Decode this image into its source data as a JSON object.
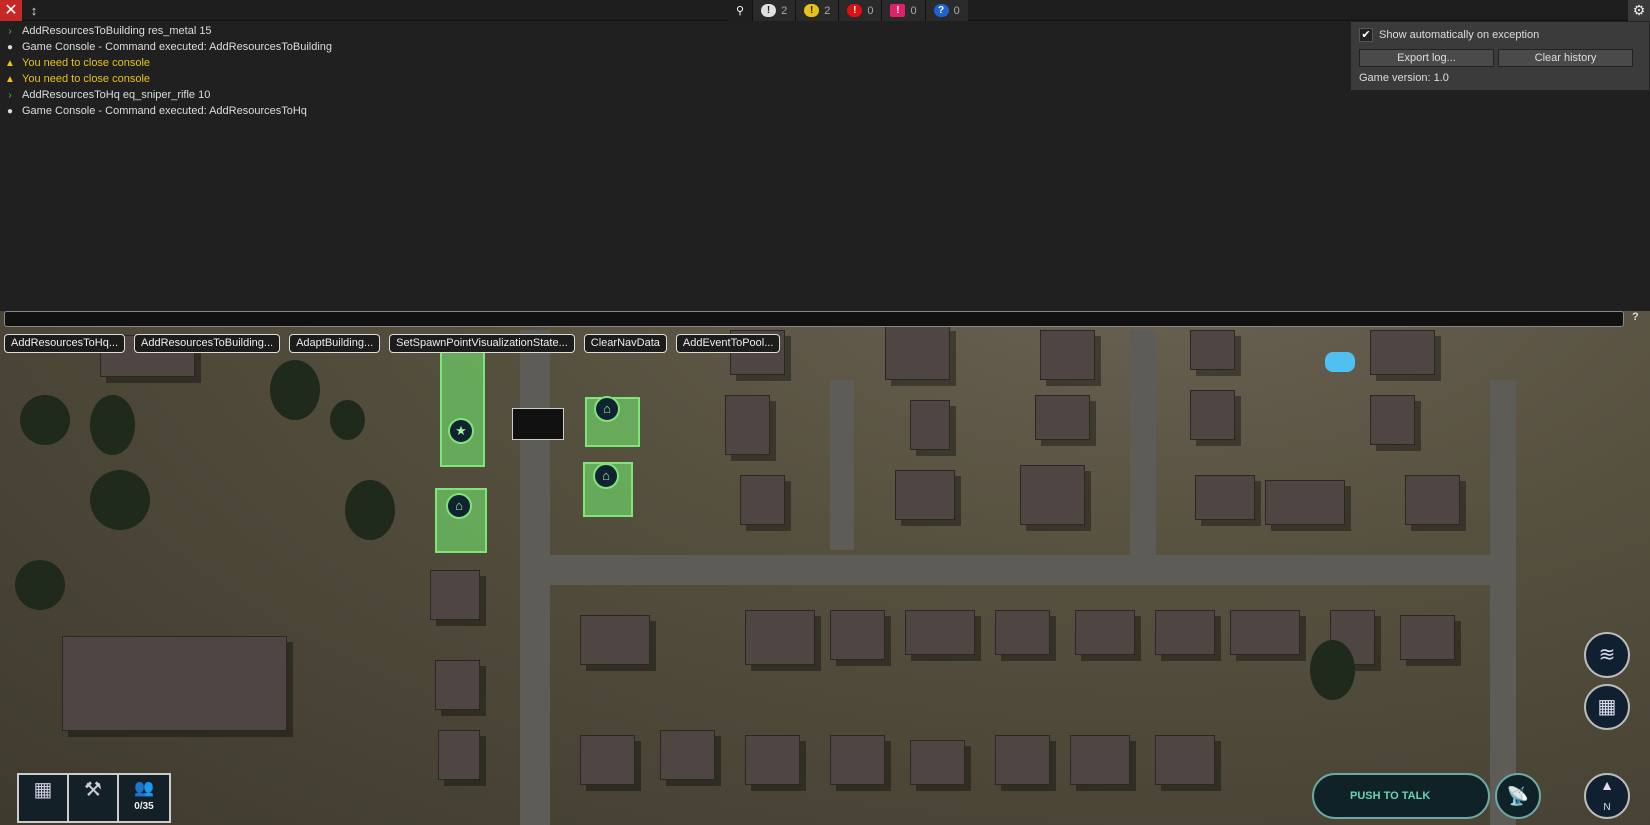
{
  "topbar": {
    "counters": [
      {
        "icon": "info-bubble-icon",
        "count": "2",
        "color": "#e0e0e0"
      },
      {
        "icon": "warning-icon",
        "count": "2",
        "color": "#e8c21a"
      },
      {
        "icon": "error-icon",
        "count": "0",
        "color": "#e01010"
      },
      {
        "icon": "exception-icon",
        "count": "0",
        "color": "#e0206a"
      },
      {
        "icon": "question-icon",
        "count": "0",
        "color": "#2060d0"
      }
    ]
  },
  "logs": [
    {
      "type": "command",
      "text": "AddResourcesToBuilding res_metal 15"
    },
    {
      "type": "info",
      "text": "Game Console - Command executed: AddResourcesToBuilding"
    },
    {
      "type": "warning",
      "text": "You need to close console"
    },
    {
      "type": "warning",
      "text": "You need to close console"
    },
    {
      "type": "command",
      "text": "AddResourcesToHq eq_sniper_rifle 10"
    },
    {
      "type": "info",
      "text": "Game Console - Command executed: AddResourcesToHq"
    }
  ],
  "settings": {
    "show_auto": "Show automatically on exception",
    "export": "Export log...",
    "clear": "Clear history",
    "version": "Game version: 1.0"
  },
  "help": "?",
  "commands": [
    "AddResourcesToHq...",
    "AddResourcesToBuilding...",
    "AdaptBuilding...",
    "SetSpawnPointVisualizationState...",
    "ClearNavData",
    "AddEventToPool..."
  ],
  "hud": {
    "population": "0/35",
    "push_to_talk": "PUSH TO TALK",
    "compass": "N"
  }
}
